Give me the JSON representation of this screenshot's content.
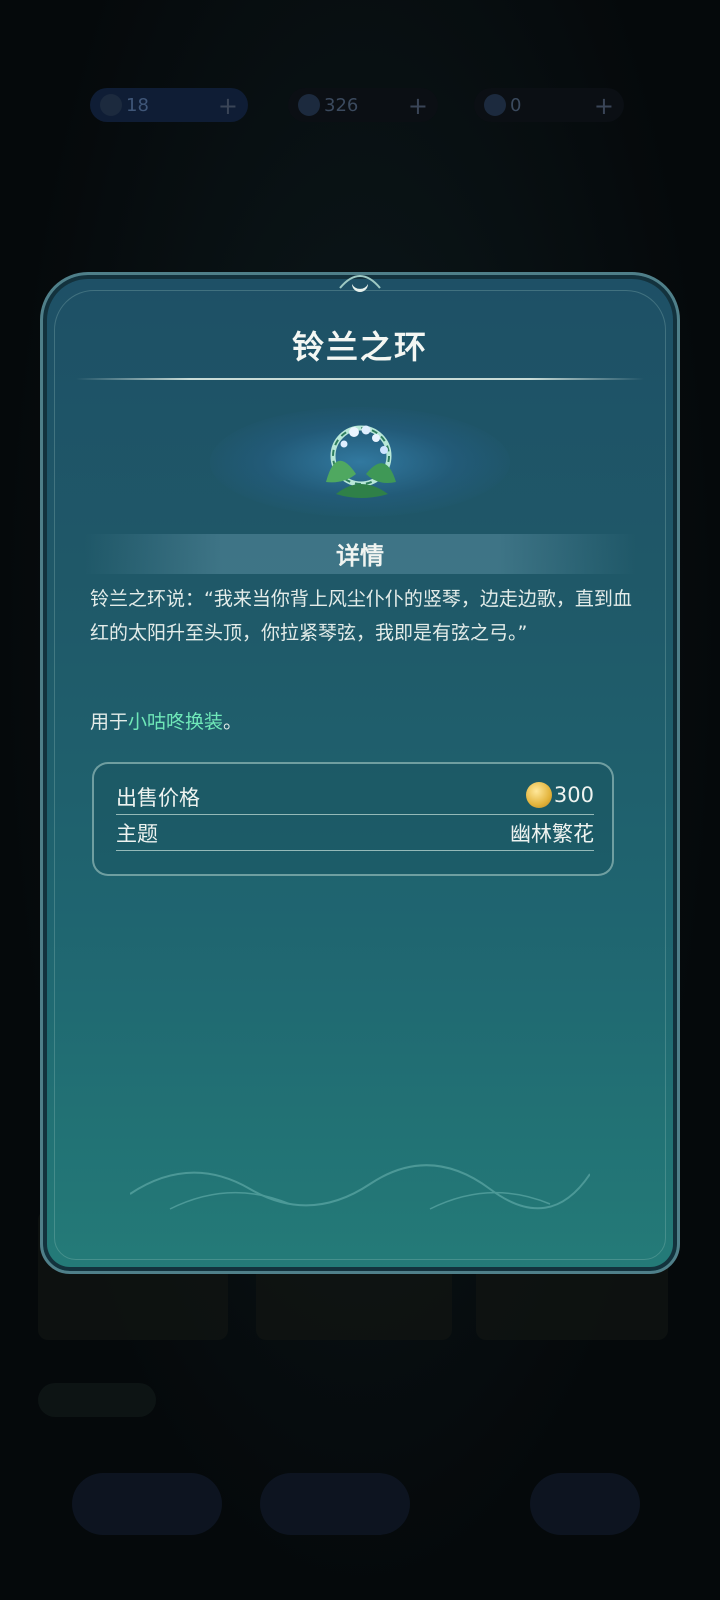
{
  "topbar": {
    "resources": [
      {
        "icon": "dream-orb-icon",
        "value": "18"
      },
      {
        "icon": "moon-coin-icon",
        "value": "326"
      },
      {
        "icon": "feather-icon",
        "value": "0"
      }
    ],
    "add_label": "+"
  },
  "dialog": {
    "title": "铃兰之环",
    "item_icon": "lily-of-the-valley-ring-icon",
    "section_title": "详情",
    "description": "铃兰之环说：“我来当你背上风尘仆仆的竖琴，边走边歌，直到血红的太阳升至头顶，你拉紧琴弦，我即是有弦之弓。”",
    "usage_prefix": "用于",
    "usage_highlight": "小咕咚换装",
    "usage_suffix": "。",
    "info": {
      "price_label": "出售价格",
      "price_icon": "gold-coin-icon",
      "price_value": "300",
      "theme_label": "主题",
      "theme_value": "幽林繁花"
    }
  },
  "colors": {
    "highlight": "#6fe8b8",
    "dialog_top": "#1e5066",
    "dialog_bottom": "#247b78"
  }
}
